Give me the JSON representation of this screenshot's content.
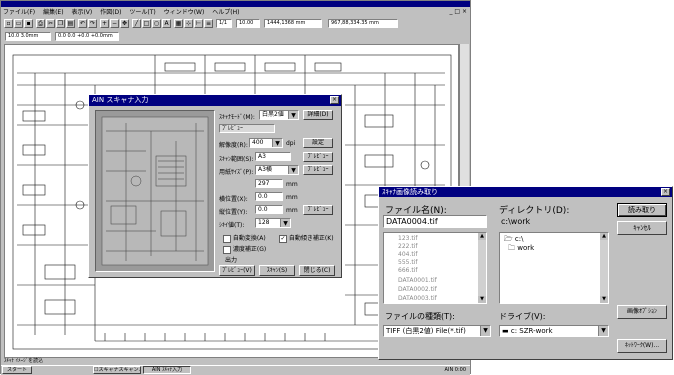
{
  "app": {
    "menu": [
      "ファイル(F)",
      "編集(E)",
      "表示(V)",
      "作図(D)",
      "ツール(T)",
      "ウィンドウ(W)",
      "ヘルプ(H)"
    ],
    "window_buttons": [
      "_",
      "□",
      "×"
    ],
    "toolbar_fields": [
      "1/1",
      "10.00",
      "1444,1368 mm",
      "967,88,334.35 mm"
    ],
    "coord_fields": [
      "10.0 3.0mm",
      "0.0 0.0 +0.0 +0.0mm"
    ],
    "status_bar": "ｽｷｬﾅ ｲﾒｰｼﾞを読込",
    "taskbar": {
      "start": "スタート",
      "items": [
        "☐スキャナスキャン...",
        "AIN ｽｷｬﾅ入力"
      ],
      "tray": "AIN 0:00"
    }
  },
  "scan_dialog": {
    "title": "AIN スキャナ入力",
    "preview_label": "ｽｷｬﾝ範囲",
    "rows": [
      {
        "label": "ｽｷｬﾅﾓｰﾄﾞ(M):",
        "value": "白黒2値",
        "button": "詳細(D)"
      },
      {
        "label": "",
        "value": "ﾌﾟﾚﾋﾞｭｰ",
        "button": ""
      },
      {
        "label": "解像度(R):",
        "value": "400",
        "unit": "dpi",
        "button": "設定"
      },
      {
        "label": "ｽｷｬﾝ範囲(S):",
        "value": "A3",
        "unit": "",
        "button": "ﾌﾟﾚﾋﾞｭｰ"
      },
      {
        "label": "用紙ｻｲｽﾞ(P):",
        "value": "A3横",
        "unit": "",
        "button": "ﾌﾟﾚﾋﾞｭｰ"
      },
      {
        "label": "",
        "value": "297",
        "unit": "mm",
        "button": ""
      },
      {
        "label": "横位置(X):",
        "value": "0.0",
        "unit": "mm",
        "button": ""
      },
      {
        "label": "縦位置(Y):",
        "value": "0.0",
        "unit": "mm",
        "button": "ﾌﾟﾚﾋﾞｭｰ"
      },
      {
        "label": "ｼｷｲ値(T):",
        "value": "128",
        "unit": "",
        "button": ""
      }
    ],
    "checks": [
      {
        "label": "自動変換(A)",
        "checked": false
      },
      {
        "label": "自動傾き補正(K)",
        "checked": true
      },
      {
        "label": "濃度補正(G)",
        "checked": false
      }
    ],
    "output_label": "出力",
    "buttons": [
      "ﾌﾟﾚﾋﾞｭｰ(V)",
      "ｽｷｬﾝ(S)",
      "閉じる(C)"
    ]
  },
  "open_dialog": {
    "title": "ｽｷｬﾅ画像読み取り",
    "filename_label": "ファイル名(N):",
    "filename_value": "DATA0004.tif",
    "files": [
      "123.tif",
      "222.tif",
      "404.tif",
      "555.tif",
      "666.tif",
      "DATA0001.tif",
      "DATA0002.tif",
      "DATA0003.tif"
    ],
    "dir_label": "ディレクトリ(D):",
    "dir_value": "c:\\work",
    "dirs": [
      "c:\\",
      "work"
    ],
    "filetype_label": "ファイルの種類(T):",
    "filetype_value": "TIFF (白黒2値) File(*.tif)",
    "drive_label": "ドライブ(V):",
    "drive_value": "c: SZR-work",
    "buttons": [
      "読み取り",
      "ｷｬﾝｾﾙ",
      "画像ｵﾌﾟｼｮﾝ",
      "ﾈｯﾄﾜｰｸ(W)..."
    ]
  }
}
